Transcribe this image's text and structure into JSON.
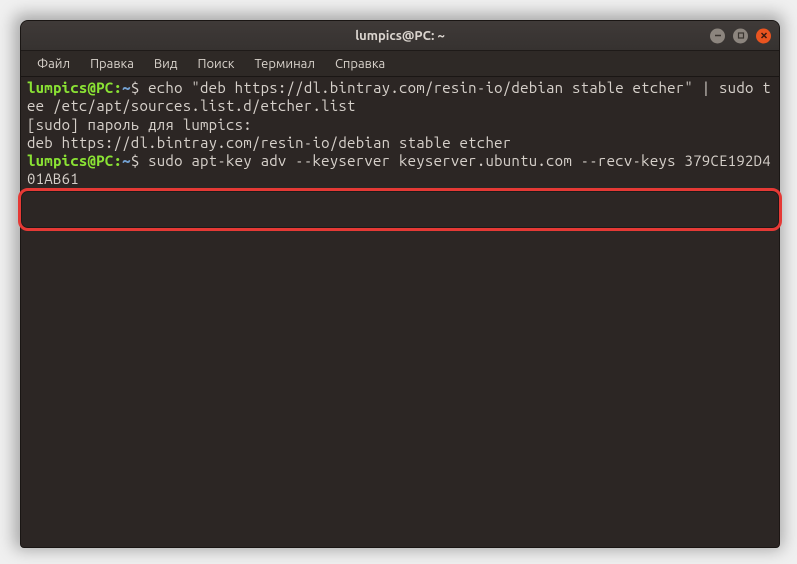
{
  "window": {
    "title": "lumpics@PC: ~"
  },
  "menu": {
    "items": [
      "Файл",
      "Правка",
      "Вид",
      "Поиск",
      "Терминал",
      "Справка"
    ]
  },
  "prompt": {
    "user_host": "lumpics@PC:",
    "path": "~",
    "dollar": "$"
  },
  "terminal": {
    "line1_cmd": " echo \"deb https://dl.bintray.com/resin-io/debian stable etcher\" | sudo tee /etc/apt/sources.list.d/etcher.list",
    "line2": "[sudo] пароль для lumpics:",
    "line3": "deb https://dl.bintray.com/resin-io/debian stable etcher",
    "line4_cmd": " sudo apt-key adv --keyserver keyserver.ubuntu.com --recv-keys 379CE192D401AB61"
  },
  "colors": {
    "highlight_border": "#e53935",
    "prompt_user": "#8ae234",
    "prompt_path": "#729fcf",
    "close_btn": "#e95420"
  }
}
